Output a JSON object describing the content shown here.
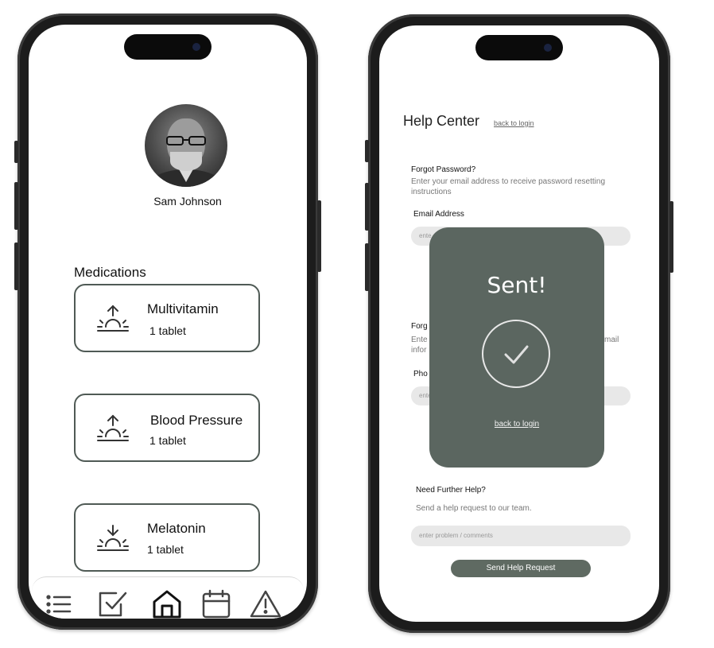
{
  "profile": {
    "name": "Sam Johnson"
  },
  "medications": {
    "title": "Medications",
    "items": [
      {
        "name": "Multivitamin",
        "dose": "1 tablet",
        "icon": "sunrise-icon"
      },
      {
        "name": "Blood Pressure",
        "dose": "1 tablet",
        "icon": "sunrise-icon"
      },
      {
        "name": "Melatonin",
        "dose": "1 tablet",
        "icon": "sunset-icon"
      }
    ]
  },
  "tabbar": {
    "items": [
      {
        "icon": "list-icon"
      },
      {
        "icon": "checkbox-icon"
      },
      {
        "icon": "home-icon",
        "active": true
      },
      {
        "icon": "calendar-icon"
      },
      {
        "icon": "alert-icon"
      }
    ]
  },
  "help": {
    "title": "Help Center",
    "back_link": "back to login",
    "forgot_password": {
      "label": "Forgot Password?",
      "desc": "Enter your email address to receive password resetting instructions",
      "email_label": "Email Address",
      "email_placeholder": "ente"
    },
    "forgot_other": {
      "label_partial": "Forg",
      "desc_partial_left": "Ente",
      "desc_partial_left2": "infor",
      "desc_partial_right": "mail",
      "phone_label_partial": "Pho",
      "phone_placeholder": "ente"
    },
    "further": {
      "label": "Need Further Help?",
      "desc": "Send a help request to our team.",
      "placeholder": "enter problem / comments",
      "button": "Send Help Request"
    },
    "modal": {
      "title": "Sent!",
      "back_link": "back to login"
    }
  },
  "colors": {
    "accent": "#5b6660",
    "card_border": "#4f5a55",
    "field_bg": "#e8e8e8"
  }
}
